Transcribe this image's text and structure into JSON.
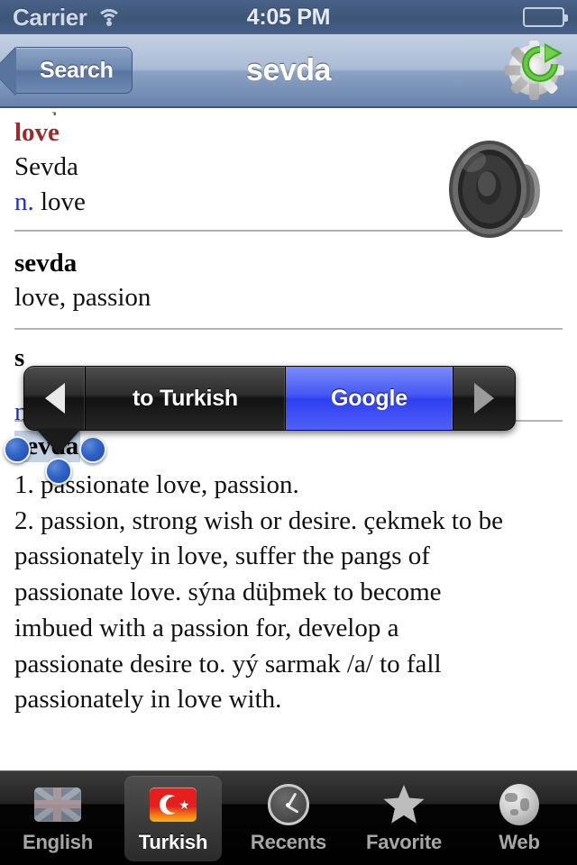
{
  "status_bar": {
    "carrier": "Carrier",
    "wifi_icon": "wifi-icon",
    "time": "4:05 PM",
    "battery_icon": "battery-icon"
  },
  "nav_bar": {
    "back_label": "Search",
    "title": "sevda",
    "action_icon": "gear-refresh-icon"
  },
  "content": {
    "clipped_top_line": "sevda",
    "speaker_icon": "speaker-icon",
    "entries": [
      {
        "headword": "love",
        "headword_color": "#9e2b2b",
        "translation": "Sevda",
        "pos": "n.",
        "gloss": "love",
        "has_speaker": true
      },
      {
        "headword": "sevda",
        "headword_color": "#000000",
        "definition": "love, passion"
      },
      {
        "headword": "s",
        "pos": "n.",
        "obscured_by_popup": true
      }
    ],
    "selection": {
      "text": "sevda",
      "highlight_color": "#c4d2e4",
      "handle_color": "#2f63c6",
      "handles": [
        "top",
        "left",
        "right",
        "bottom"
      ]
    },
    "definition_lines": [
      "1. passionate love, passion.",
      "2. passion, strong wish or desire.  çekmek to be",
      "passionately in love, suffer the pangs of",
      "passionate love. sýna düþmek to become",
      "imbued with a passion for, develop a",
      "passionate desire to. yý sarmak /a/ to fall",
      "passionately in love with."
    ]
  },
  "popup_menu": {
    "prev_arrow_icon": "triangle-left-icon",
    "next_arrow_icon": "triangle-right-icon",
    "items": [
      {
        "label": "to Turkish",
        "highlighted": false
      },
      {
        "label": "Google",
        "highlighted": true
      }
    ],
    "highlight_color": "#4356f2"
  },
  "tab_bar": {
    "tabs": [
      {
        "label": "English",
        "icon": "uk-flag-icon",
        "active": false
      },
      {
        "label": "Turkish",
        "icon": "turkish-flag-icon",
        "active": true
      },
      {
        "label": "Recents",
        "icon": "clock-icon",
        "active": false
      },
      {
        "label": "Favorite",
        "icon": "star-icon",
        "active": false
      },
      {
        "label": "Web",
        "icon": "globe-icon",
        "active": false
      }
    ]
  }
}
